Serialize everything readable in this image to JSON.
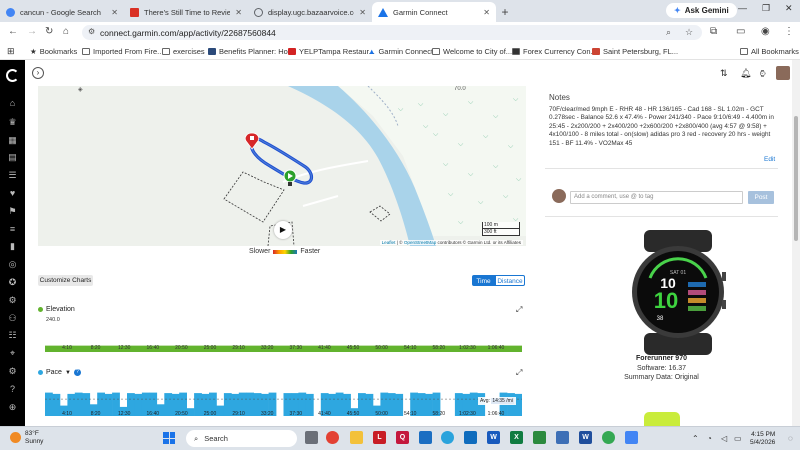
{
  "browser": {
    "tabs": [
      {
        "title": "cancun - Google Search",
        "color": "#4285f4"
      },
      {
        "title": "There's Still Time to Review Yo",
        "color": "#d93025"
      },
      {
        "title": "display.ugc.bazaarvoice.com/st",
        "color": "#5f6368"
      },
      {
        "title": "Garmin Connect",
        "color": "#1a73e8",
        "active": true
      }
    ],
    "new_tab": "+",
    "gemini_label": "Ask Gemini",
    "url": "connect.garmin.com/app/activity/22687560844",
    "bookmarks": [
      {
        "label": "Bookmarks"
      },
      {
        "label": "Imported From Fire..."
      },
      {
        "label": "exercises"
      },
      {
        "label": "Benefits Planner: Ho..."
      },
      {
        "label": "YELPTampa Restaur..."
      },
      {
        "label": "Garmin Connect"
      },
      {
        "label": "Welcome to City of..."
      },
      {
        "label": "Forex Currency Con..."
      },
      {
        "label": "Saint Petersburg, FL..."
      }
    ],
    "all_bookmarks": "All Bookmarks"
  },
  "map": {
    "legend_slower": "Slower",
    "legend_faster": "Faster",
    "scale_m": "100 m",
    "scale_ft": "300 ft",
    "attrib_leaflet": "Leaflet",
    "attrib_sep": " | © ",
    "attrib_osm": "OpenStreetMap",
    "attrib_rest": " contributors © Garmin Ltd. or its Affiliates",
    "zoom_readout": "70.0"
  },
  "charts": {
    "customize_label": "Customize Charts",
    "toggle_time": "Time",
    "toggle_distance": "Distance",
    "elevation_title": "Elevation",
    "elevation_ymax": "240.0",
    "pace_title": "Pace",
    "pace_avg_label": "Avg:",
    "pace_avg_value": "14:35 /mi",
    "elevation_color": "#62b32e",
    "pace_color": "#2ea7e0"
  },
  "chart_data": [
    {
      "type": "area",
      "title": "Elevation",
      "xlabel": "",
      "ylabel": "",
      "x_ticks": [
        "4:10",
        "8:20",
        "12:30",
        "16:40",
        "20:50",
        "25:00",
        "29:10",
        "33:20",
        "37:30",
        "41:40",
        "45:50",
        "50:00",
        "54:10",
        "58:20",
        "1:02:30",
        "1:06:40"
      ],
      "ylim": [
        0,
        240
      ],
      "values": [
        150,
        150,
        150,
        150,
        150,
        150,
        150,
        150,
        150,
        150,
        150,
        150,
        150,
        150,
        150,
        150,
        150,
        150,
        150,
        150,
        150,
        150,
        150,
        150,
        150,
        150,
        150,
        150,
        150,
        150,
        150,
        150,
        150,
        150,
        150,
        150,
        150,
        150,
        150,
        150
      ]
    },
    {
      "type": "bar",
      "title": "Pace",
      "x_ticks": [
        "4:10",
        "8:20",
        "12:30",
        "16:40",
        "20:50",
        "25:00",
        "29:10",
        "33:20",
        "37:30",
        "41:40",
        "45:50",
        "50:00",
        "54:10",
        "58:20",
        "1:02:30",
        "1:06:40"
      ],
      "values": [
        0.9,
        0.85,
        0.4,
        0.85,
        0.9,
        0.88,
        0.45,
        0.9,
        0.85,
        0.9,
        0.35,
        0.88,
        0.85,
        0.9,
        0.9,
        0.45,
        0.88,
        0.85,
        0.9,
        0.3,
        0.88,
        0.85,
        0.9,
        0.4,
        0.88,
        0.85,
        0.9,
        0.9,
        0.88,
        0.85,
        0.9,
        0.0,
        0.88,
        0.88,
        0.9,
        0.85,
        0.0,
        0.88,
        0.85,
        0.9,
        0.85,
        0.3,
        0.88,
        0.85,
        0.4,
        0.9,
        0.88,
        0.85,
        0.0,
        0.9,
        0.88,
        0.85,
        0.9,
        0.0,
        0.0,
        0.88,
        0.85,
        0.9,
        0.88,
        0.0,
        0.0,
        0.9,
        0.88,
        0.85
      ],
      "avg": "14:35 /mi"
    }
  ],
  "notes": {
    "heading": "Notes",
    "text": "70F/clear/med 9mph E - RHR 48 - HR 136/165 - Cad 168 - SL 1.02m - GCT 0.278sec - Balance 52.6 x 47.4% - Power 241/340 - Pace 9:10/6:49 - 4.400m in 25:45 - 2x200/200 + 2x400/200 +2x600/200 +2x800/400 (avg 4:57 @ 9:58) + 4x100/100 - 8 miles total - on(slow) adidas pro 3 red - recovery 20 hrs - weight 151 - BF 11.4% - VO2Max 45",
    "edit_label": "Edit",
    "comment_placeholder": "Add a comment, use @ to tag",
    "post_label": "Post"
  },
  "device": {
    "name": "Forerunner 970",
    "software": "Software: 16.37",
    "summary": "Summary Data: Original",
    "face_big": "10",
    "face_small": "38"
  },
  "taskbar": {
    "temp": "83°F",
    "condition": "Sunny",
    "search_label": "Search",
    "time": "4:15 PM",
    "date": "5/4/2026"
  }
}
